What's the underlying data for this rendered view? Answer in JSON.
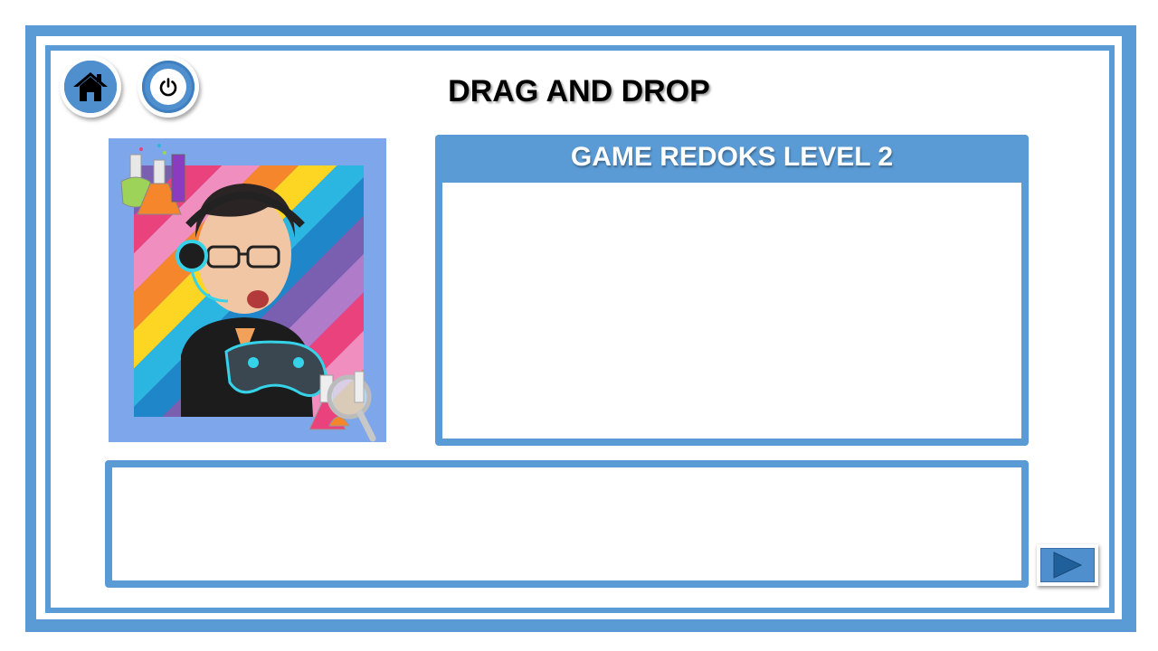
{
  "header": {
    "title": "DRAG AND DROP"
  },
  "nav": {
    "home_icon": "home-icon",
    "power_icon": "power-icon",
    "next_icon": "play-arrow-icon"
  },
  "question_panel": {
    "title": "GAME REDOKS LEVEL 2",
    "body": ""
  },
  "answer_area": {
    "text": ""
  },
  "colors": {
    "frame": "#5b9bd5",
    "button": "#4f8fce",
    "avatar_bg": "#7da7ea"
  }
}
